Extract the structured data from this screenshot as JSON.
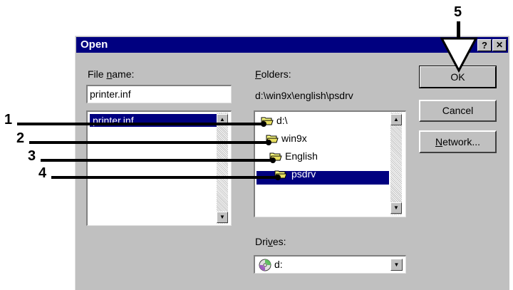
{
  "dialog": {
    "title": "Open",
    "help_label": "?",
    "close_label": "✕"
  },
  "file_name": {
    "label": "File name:",
    "value": "printer.inf",
    "list": [
      "printer.inf"
    ]
  },
  "folders": {
    "label": "Folders:",
    "path": "d:\\win9x\\english\\psdrv",
    "items": [
      "d:\\",
      "win9x",
      "English",
      "psdrv"
    ],
    "selected": "psdrv"
  },
  "drives": {
    "label": "Drives:",
    "value": "d:"
  },
  "buttons": {
    "ok": "OK",
    "cancel": "Cancel",
    "network": "Network..."
  },
  "callouts": [
    "1",
    "2",
    "3",
    "4",
    "5"
  ],
  "colors": {
    "titlebar": "#000080",
    "face": "#c0c0c0",
    "selection": "#000080"
  }
}
